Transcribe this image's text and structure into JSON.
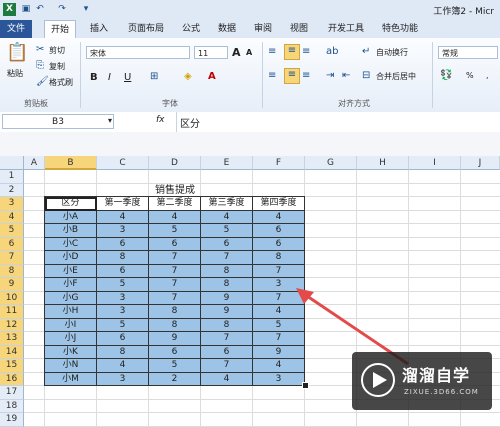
{
  "window": {
    "title": "工作簿2 - Micr"
  },
  "ribbon_tabs": [
    "文件",
    "开始",
    "插入",
    "页面布局",
    "公式",
    "数据",
    "审阅",
    "视图",
    "开发工具",
    "特色功能"
  ],
  "clipboard": {
    "paste": "粘贴",
    "cut": "剪切",
    "copy": "复制",
    "format_painter": "格式刷",
    "group": "剪贴板"
  },
  "font": {
    "name": "宋体",
    "size": "11",
    "group": "字体",
    "bold": "B",
    "italic": "I",
    "underline": "U",
    "grow": "A",
    "shrink": "A"
  },
  "alignment": {
    "wrap": "自动换行",
    "merge": "合并后居中",
    "group": "对齐方式"
  },
  "number": {
    "format": "常规",
    "percent": "%",
    "comma": ","
  },
  "formula_bar": {
    "name_box": "B3",
    "fx": "fx",
    "content": "区分"
  },
  "columns": [
    "A",
    "B",
    "C",
    "D",
    "E",
    "F",
    "G",
    "H",
    "I",
    "J"
  ],
  "rows": [
    "1",
    "2",
    "3",
    "4",
    "5",
    "6",
    "7",
    "8",
    "9",
    "10",
    "11",
    "12",
    "13",
    "14",
    "15",
    "16",
    "17",
    "18",
    "19"
  ],
  "sheet": {
    "title": "销售提成",
    "headers": [
      "区分",
      "第一季度",
      "第二季度",
      "第三季度",
      "第四季度"
    ],
    "data": [
      [
        "小A",
        "4",
        "4",
        "4",
        "4"
      ],
      [
        "小B",
        "3",
        "5",
        "5",
        "6"
      ],
      [
        "小C",
        "6",
        "6",
        "6",
        "6"
      ],
      [
        "小D",
        "8",
        "7",
        "7",
        "8"
      ],
      [
        "小E",
        "6",
        "7",
        "8",
        "7"
      ],
      [
        "小F",
        "5",
        "7",
        "8",
        "3"
      ],
      [
        "小G",
        "3",
        "7",
        "9",
        "7"
      ],
      [
        "小H",
        "3",
        "8",
        "9",
        "4"
      ],
      [
        "小I",
        "5",
        "8",
        "8",
        "5"
      ],
      [
        "小J",
        "6",
        "9",
        "7",
        "7"
      ],
      [
        "小K",
        "8",
        "6",
        "6",
        "9"
      ],
      [
        "小N",
        "4",
        "5",
        "7",
        "4"
      ],
      [
        "小M",
        "3",
        "2",
        "4",
        "3"
      ]
    ]
  },
  "watermark": {
    "brand": "溜溜自学",
    "url": "ZIXUE.3D66.COM"
  },
  "colors": {
    "accent": "#2b579a",
    "table_fill": "#9dc3e6",
    "arrow": "#e34a4a",
    "excel_green": "#1f7a3f"
  }
}
